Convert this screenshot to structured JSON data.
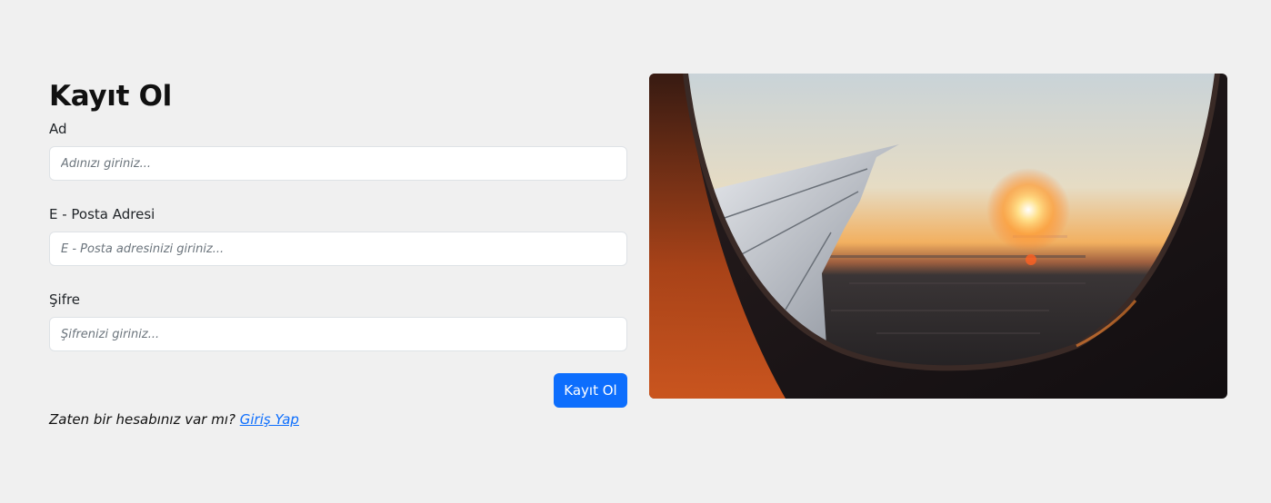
{
  "form": {
    "title": "Kayıt Ol",
    "name_label": "Ad",
    "name_placeholder": "Adınızı giriniz...",
    "email_label": "E - Posta Adresi",
    "email_placeholder": "E - Posta adresinizi giriniz...",
    "password_label": "Şifre",
    "password_placeholder": "Şifrenizi giriniz...",
    "submit_label": "Kayıt Ol",
    "login_prompt": "Zaten bir hesabınız var mı? ",
    "login_link": "Giriş Yap"
  },
  "colors": {
    "background": "#f0f0f0",
    "primary": "#0d6efd",
    "link": "#0d6efd"
  },
  "image": {
    "subject": "airplane-window-sunset-photo"
  }
}
